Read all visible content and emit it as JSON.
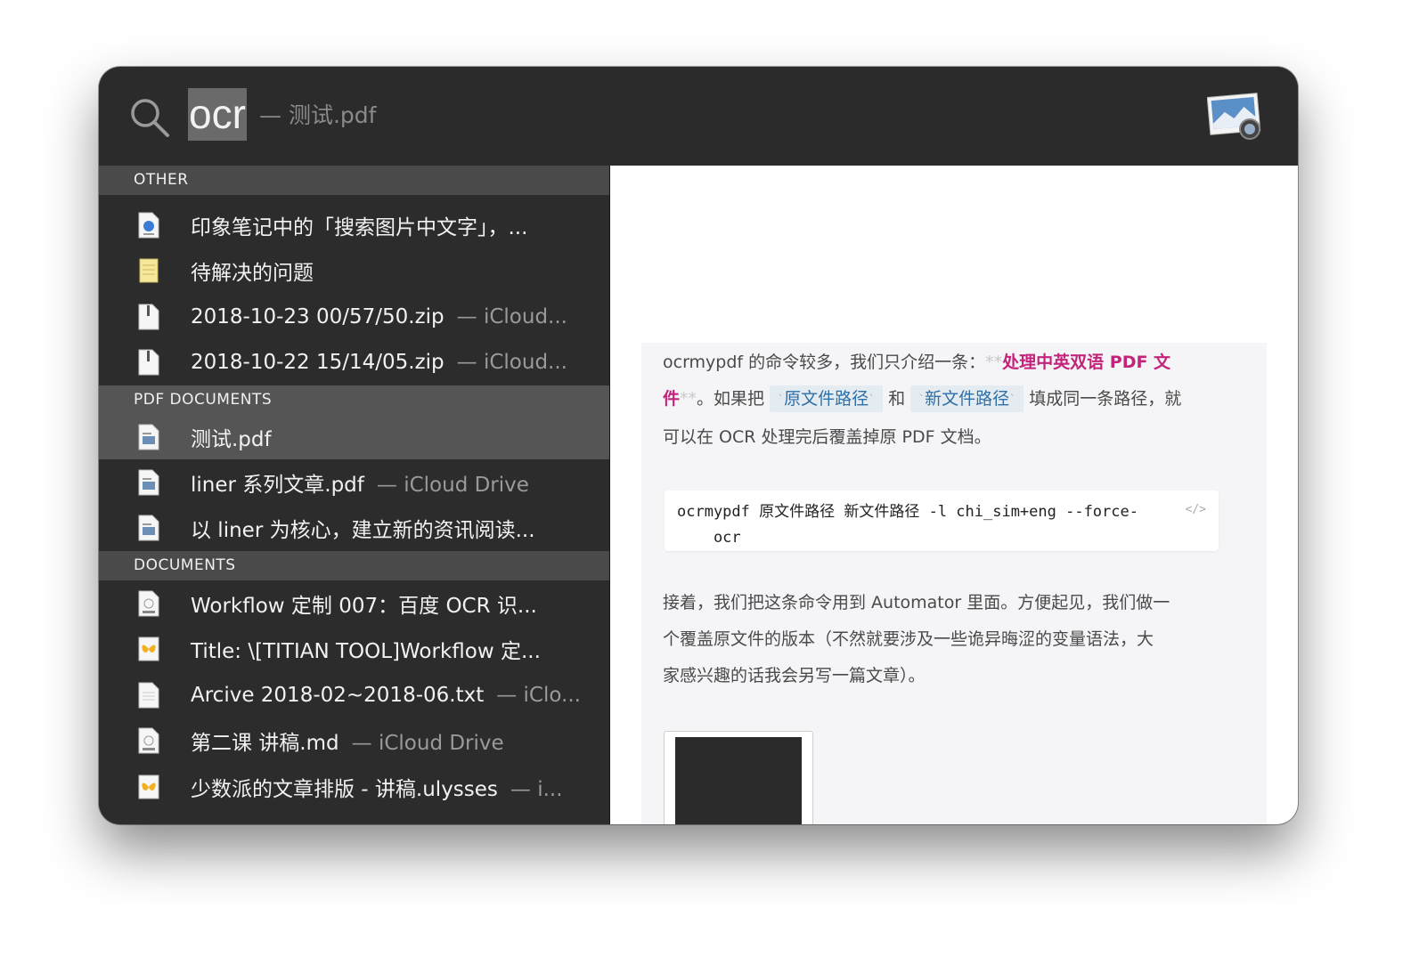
{
  "search": {
    "query": "ocr",
    "suffix": "— 测试.pdf"
  },
  "sections": [
    {
      "header": "OTHER",
      "items": [
        {
          "title": "印象笔记中的「搜索图片中文字」，...",
          "sub": "",
          "icon": "webloc-file-icon"
        },
        {
          "title": "待解决的问题",
          "sub": "",
          "icon": "note-icon"
        },
        {
          "title": "2018-10-23 00/57/50.zip",
          "sub": "— iCloud...",
          "icon": "zip-file-icon"
        },
        {
          "title": "2018-10-22 15/14/05.zip",
          "sub": "— iCloud...",
          "icon": "zip-file-icon"
        }
      ]
    },
    {
      "header": "PDF DOCUMENTS",
      "items": [
        {
          "title": "测试.pdf",
          "sub": "",
          "icon": "pdf-file-icon",
          "selected": true
        },
        {
          "title": "liner 系列文章.pdf",
          "sub": "— iCloud Drive",
          "icon": "pdf-file-icon"
        },
        {
          "title": "以 liner 为核心，建立新的资讯阅读...",
          "sub": "",
          "icon": "pdf-file-icon"
        }
      ]
    },
    {
      "header": "DOCUMENTS",
      "items": [
        {
          "title": "Workflow 定制 007：百度 OCR 识...",
          "sub": "",
          "icon": "md-file-icon"
        },
        {
          "title": "Title: \\[TITIAN TOOL]Workflow 定...",
          "sub": "",
          "icon": "ulysses-file-icon"
        },
        {
          "title": "Arcive 2018-02~2018-06.txt",
          "sub": "— iClo...",
          "icon": "txt-file-icon"
        },
        {
          "title": "第二课 讲稿.md",
          "sub": "— iCloud Drive",
          "icon": "md-file-icon"
        },
        {
          "title": "少数派的文章排版 - 讲稿.ulysses",
          "sub": "— i...",
          "icon": "ulysses-file-icon"
        }
      ]
    }
  ],
  "preview": {
    "p1_a": "ocrmypdf 的命令较多，我们只介绍一条：",
    "p1_mark": "**",
    "p1_bold_a": "处理中英双语 PDF 文",
    "p1_bold_b": "件",
    "p1_mark2": "**",
    "p1_b": "。如果把 ",
    "p1_code1": "原文件路径",
    "p1_c": " 和 ",
    "p1_code2": "新文件路径",
    "p1_d": " 填成同一条路径，就",
    "p1_e": "可以在 OCR 处理完后覆盖掉原 PDF 文档。",
    "code_line1": "ocrmypdf 原文件路径 新文件路径 -l chi_sim+eng --force-",
    "code_line2": "    ocr",
    "code_tag": "</>",
    "p2_l1": "接着，我们把这条命令用到 Automator 里面。方便起见，我们做一",
    "p2_l2": "个覆盖原文件的版本（不然就要涉及一些诡异晦涩的变量语法，大",
    "p2_l3": "家感兴趣的话我会另写一篇文章）。",
    "tick": "`"
  },
  "colors": {
    "accent_pink": "#c3237a",
    "inline_code_bg": "#e4ecf2",
    "inline_code_text": "#2f6fa8",
    "selection": "#555555"
  }
}
